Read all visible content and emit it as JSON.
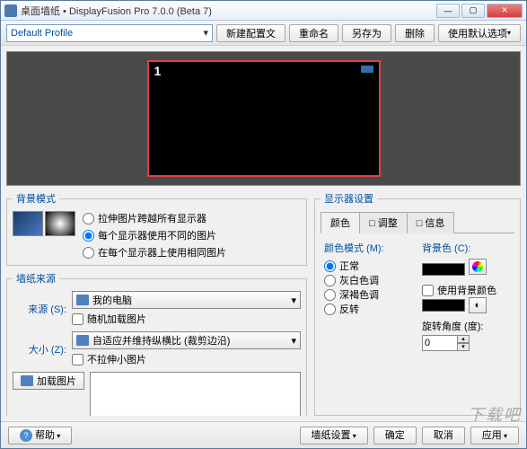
{
  "titlebar": {
    "icon": "app-icon",
    "text": "桌面墙纸 • DisplayFusion Pro 7.0.0 (Beta 7)"
  },
  "win": {
    "min": "—",
    "max": "▢",
    "close": "✕"
  },
  "toolbar": {
    "profile": "Default Profile",
    "new": "新建配置文",
    "rename": "重命名",
    "saveas": "另存为",
    "delete": "删除",
    "defaults": "使用默认选项"
  },
  "preview": {
    "monitor_number": "1"
  },
  "bgmode": {
    "legend": "背景模式",
    "opt1": "拉伸图片跨越所有显示器",
    "opt2": "每个显示器使用不同的图片",
    "opt3": "在每个显示器上使用相同图片",
    "selected": "opt2"
  },
  "source": {
    "legend": "墙纸来源",
    "src_label": "来源 (S):",
    "src_value": "我的电脑",
    "random": "随机加载图片",
    "size_label": "大小 (Z):",
    "size_value": "自适应并维持纵横比 (裁剪边沿)",
    "nostretch": "不拉伸小图片",
    "load_btn": "加载图片"
  },
  "display": {
    "legend": "显示器设置",
    "tabs": {
      "color": "颜色",
      "adjust": "调整",
      "info": "信息"
    },
    "active_tab": "color",
    "color_mode_label": "颜色模式 (M):",
    "modes": {
      "normal": "正常",
      "gray": "灰白色调",
      "sepia": "深褐色调",
      "invert": "反转"
    },
    "mode_selected": "normal",
    "bgcolor_label": "背景色 (C):",
    "usebg": "使用背景颜色",
    "rot_label": "旋转角度 (度):",
    "rot_value": "0"
  },
  "footer": {
    "help": "帮助",
    "wpsettings": "墙纸设置",
    "ok": "确定",
    "cancel": "取消",
    "apply": "应用"
  },
  "watermark": "下载吧"
}
